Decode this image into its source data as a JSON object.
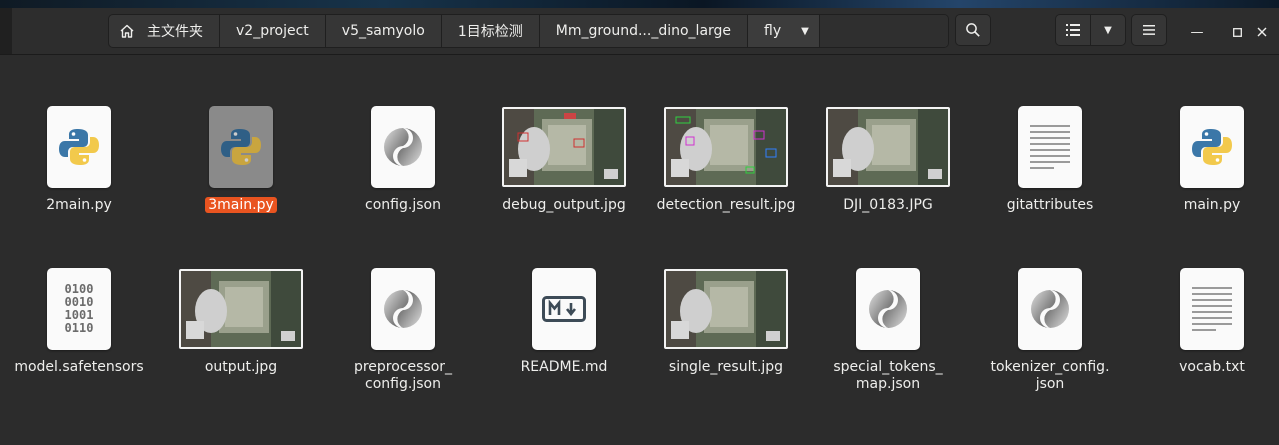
{
  "pathbar": {
    "crumbs": [
      "主文件夹",
      "v2_project",
      "v5_samyolo",
      "1目标检测",
      "Mm_ground..._dino_large",
      "fly"
    ]
  },
  "icons": {
    "home": "home-icon",
    "search": "search-icon",
    "list_view": "list-view-icon",
    "view_dropdown": "chevron-down-icon",
    "menu": "hamburger-menu-icon",
    "minimize": "minimize-icon",
    "maximize": "maximize-icon",
    "close": "close-icon"
  },
  "colors": {
    "background": "#2c2c2c",
    "selection": "#e95420",
    "python_blue": "#3b77a8",
    "python_yellow": "#f2c94c"
  },
  "files": [
    {
      "name": "2main.py",
      "type": "python",
      "selected": false
    },
    {
      "name": "3main.py",
      "type": "python",
      "selected": true
    },
    {
      "name": "config.json",
      "type": "json",
      "selected": false
    },
    {
      "name": "debug_output.jpg",
      "type": "image",
      "selected": false
    },
    {
      "name": "detection_result.jpg",
      "type": "image",
      "selected": false
    },
    {
      "name": "DJI_0183.JPG",
      "type": "image",
      "selected": false
    },
    {
      "name": "gitattributes",
      "type": "text",
      "selected": false
    },
    {
      "name": "main.py",
      "type": "python",
      "selected": false
    },
    {
      "name": "model.safetensors",
      "type": "binary",
      "selected": false
    },
    {
      "name": "output.jpg",
      "type": "image",
      "selected": false
    },
    {
      "name": "preprocessor_\nconfig.json",
      "type": "json",
      "selected": false
    },
    {
      "name": "README.md",
      "type": "markdown",
      "selected": false
    },
    {
      "name": "single_result.jpg",
      "type": "image",
      "selected": false
    },
    {
      "name": "special_tokens_\nmap.json",
      "type": "json",
      "selected": false
    },
    {
      "name": "tokenizer_config.\njson",
      "type": "json",
      "selected": false
    },
    {
      "name": "vocab.txt",
      "type": "text",
      "selected": false
    }
  ]
}
